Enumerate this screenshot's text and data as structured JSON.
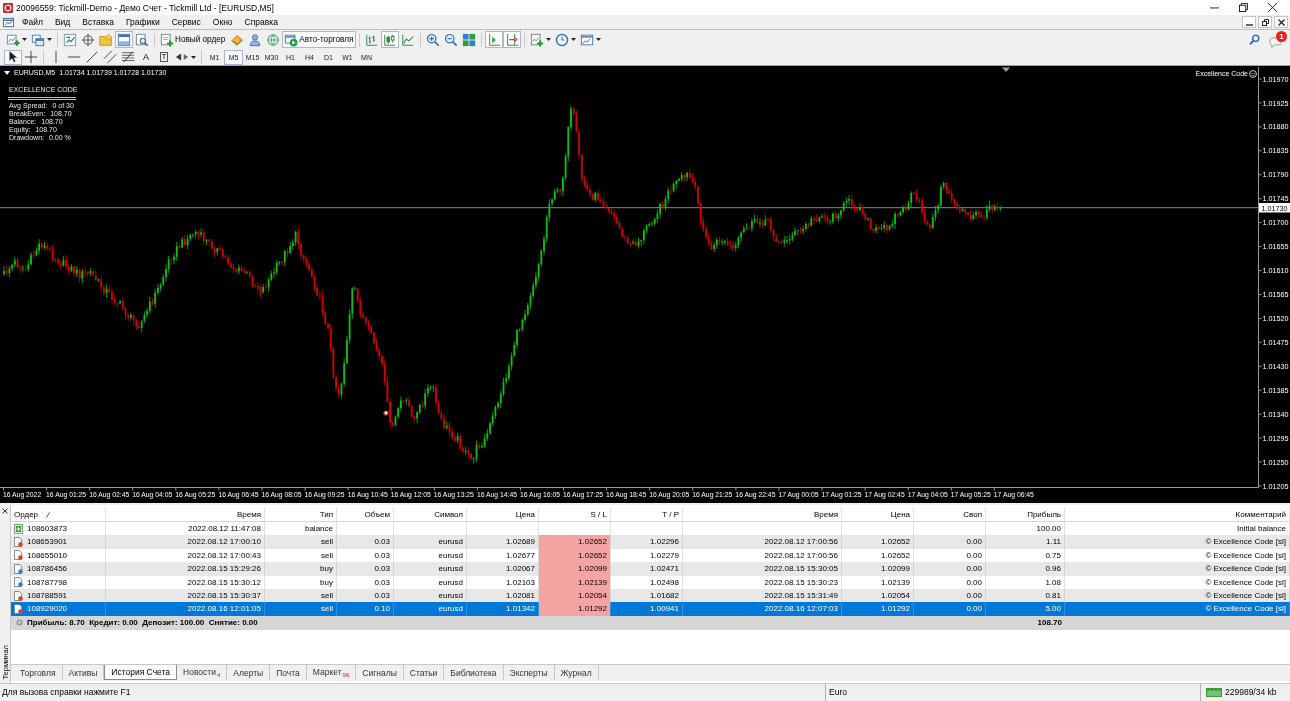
{
  "window": {
    "title": "20096559: Tickmill-Demo - Демо Счет - Tickmill Ltd - [EURUSD,M5]"
  },
  "menu": [
    "Файл",
    "Вид",
    "Вставка",
    "Графики",
    "Сервис",
    "Окно",
    "Справка"
  ],
  "toolbar": [
    [
      {
        "kind": "new-chart",
        "pressed": false
      },
      {
        "kind": "profiles",
        "pressed": false
      }
    ],
    [
      {
        "kind": "market-watch",
        "pressed": false
      },
      {
        "kind": "data-window",
        "pressed": false
      },
      {
        "kind": "navigator",
        "pressed": false
      },
      {
        "kind": "terminal",
        "pressed": true
      },
      {
        "kind": "tester",
        "pressed": false
      }
    ],
    [
      {
        "kind": "new-order",
        "label": "Новый ордер",
        "pressed": false
      },
      {
        "kind": "metaeditor",
        "pressed": false
      },
      {
        "kind": "signals",
        "pressed": false
      },
      {
        "kind": "market",
        "pressed": false
      },
      {
        "kind": "auto-trading",
        "label": "Авто-торговля",
        "pressed": true
      }
    ],
    [
      {
        "kind": "bar-chart",
        "pressed": false
      },
      {
        "kind": "candles",
        "pressed": true
      },
      {
        "kind": "line-chart",
        "pressed": false
      }
    ],
    [
      {
        "kind": "zoom-in",
        "pressed": false
      },
      {
        "kind": "zoom-out",
        "pressed": false
      },
      {
        "kind": "tile",
        "pressed": false
      }
    ],
    [
      {
        "kind": "autoscroll",
        "pressed": true
      },
      {
        "kind": "chart-shift",
        "pressed": true
      }
    ],
    [
      {
        "kind": "indicators",
        "pressed": false
      },
      {
        "kind": "periods",
        "pressed": false
      },
      {
        "kind": "templates",
        "pressed": false
      }
    ]
  ],
  "notifications": {
    "count": "1"
  },
  "drawing_toolbar": [
    [
      {
        "kind": "cursor",
        "pressed": true
      },
      {
        "kind": "crosshair",
        "pressed": false
      }
    ],
    [
      {
        "kind": "vline",
        "pressed": false
      },
      {
        "kind": "hline",
        "pressed": false
      },
      {
        "kind": "trendline",
        "pressed": false
      },
      {
        "kind": "channel",
        "pressed": false
      },
      {
        "kind": "fibo",
        "pressed": false
      },
      {
        "kind": "text-tool",
        "glyph": "A",
        "pressed": false
      },
      {
        "kind": "label-tool",
        "glyph": "T",
        "pressed": false
      },
      {
        "kind": "arrows",
        "pressed": false
      }
    ]
  ],
  "timeframes": [
    {
      "label": "M1",
      "selected": false
    },
    {
      "label": "M5",
      "selected": true
    },
    {
      "label": "M15",
      "selected": false
    },
    {
      "label": "M30",
      "selected": false
    },
    {
      "label": "H1",
      "selected": false
    },
    {
      "label": "H4",
      "selected": false
    },
    {
      "label": "D1",
      "selected": false
    },
    {
      "label": "W1",
      "selected": false
    },
    {
      "label": "MN",
      "selected": false
    }
  ],
  "chart": {
    "symbol": "EURUSD,M5",
    "quote": "1.01734 1.01739 1.01728 1.01730",
    "expert": "Excellence Code",
    "panel": {
      "title": "EXCELLENCE CODE",
      "stats": [
        {
          "label": "Avg Spread:",
          "value": "0 of 30"
        },
        {
          "label": "BreakEven:",
          "value": "108.70"
        },
        {
          "label": "Balance:",
          "value": "108.70"
        },
        {
          "label": "Equity:",
          "value": "108.70"
        },
        {
          "label": "Drawdown:",
          "value": "0.00 %"
        }
      ]
    },
    "price_labels": [
      "1.01970",
      "1.01925",
      "1.01880",
      "1.01835",
      "1.01790",
      "1.01745",
      "1.01700",
      "1.01655",
      "1.01610",
      "1.01565",
      "1.01520",
      "1.01475",
      "1.01430",
      "1.01385",
      "1.01340",
      "1.01295",
      "1.01250",
      "1.01205"
    ],
    "current_price": "1.01730",
    "time_labels": [
      "16 Aug 2022",
      "16 Aug 01:25",
      "16 Aug 02:45",
      "16 Aug 04:05",
      "16 Aug 05:25",
      "16 Aug 06:45",
      "16 Aug 08:05",
      "16 Aug 09:25",
      "16 Aug 10:45",
      "16 Aug 12:05",
      "16 Aug 13:25",
      "16 Aug 14:45",
      "16 Aug 16:05",
      "16 Aug 17:25",
      "16 Aug 18:45",
      "16 Aug 20:05",
      "16 Aug 21:25",
      "16 Aug 22:45",
      "17 Aug 00:05",
      "17 Aug 01:25",
      "17 Aug 02:45",
      "17 Aug 04:05",
      "17 Aug 05:25",
      "17 Aug 06:45"
    ]
  },
  "terminal": {
    "title": "Терминал",
    "columns": [
      "Ордер",
      "Время",
      "Тип",
      "Объем",
      "Символ",
      "Цена",
      "S / L",
      "T / P",
      "Время",
      "Цена",
      "Своп",
      "Прибыль",
      "Комментарий"
    ],
    "rows": [
      {
        "kind": "balance",
        "selected": false,
        "sl_hit": false,
        "order": "108603873",
        "open_time": "2022.08.12 11:47:08",
        "type": "balance",
        "profit": "100.00",
        "comment": "Initial balance"
      },
      {
        "kind": "sell",
        "selected": false,
        "sl_hit": true,
        "order": "108653901",
        "open_time": "2022.08.12 17:00:10",
        "type": "sell",
        "volume": "0.03",
        "symbol": "eurusd",
        "open_price": "1.02689",
        "sl": "1.02652",
        "tp": "1.02296",
        "close_time": "2022.08.12 17:00:56",
        "close_price": "1.02652",
        "swap": "0.00",
        "profit": "1.11",
        "comment": "© Excellence Code [sl]"
      },
      {
        "kind": "sell",
        "selected": false,
        "sl_hit": true,
        "order": "108655010",
        "open_time": "2022.08.12 17:00:43",
        "type": "sell",
        "volume": "0.03",
        "symbol": "eurusd",
        "open_price": "1.02677",
        "sl": "1.02652",
        "tp": "1.02279",
        "close_time": "2022.08.12 17:00:56",
        "close_price": "1.02652",
        "swap": "0.00",
        "profit": "0.75",
        "comment": "© Excellence Code [sl]"
      },
      {
        "kind": "buy",
        "selected": false,
        "sl_hit": true,
        "order": "108786456",
        "open_time": "2022.08.15 15:29:26",
        "type": "buy",
        "volume": "0.03",
        "symbol": "eurusd",
        "open_price": "1.02067",
        "sl": "1.02099",
        "tp": "1.02471",
        "close_time": "2022.08.15 15:30:05",
        "close_price": "1.02099",
        "swap": "0.00",
        "profit": "0.96",
        "comment": "© Excellence Code [sl]"
      },
      {
        "kind": "buy",
        "selected": false,
        "sl_hit": true,
        "order": "108787798",
        "open_time": "2022.08.15 15:30:12",
        "type": "buy",
        "volume": "0.03",
        "symbol": "eurusd",
        "open_price": "1.02103",
        "sl": "1.02139",
        "tp": "1.02498",
        "close_time": "2022.08.15 15:30:23",
        "close_price": "1.02139",
        "swap": "0.00",
        "profit": "1.08",
        "comment": "© Excellence Code [sl]"
      },
      {
        "kind": "sell",
        "selected": false,
        "sl_hit": true,
        "order": "108788591",
        "open_time": "2022.08.15 15:30:37",
        "type": "sell",
        "volume": "0.03",
        "symbol": "eurusd",
        "open_price": "1.02081",
        "sl": "1.02054",
        "tp": "1.01682",
        "close_time": "2022.08.15 15:31:49",
        "close_price": "1.02054",
        "swap": "0.00",
        "profit": "0.81",
        "comment": "© Excellence Code [sl]"
      },
      {
        "kind": "sell",
        "selected": true,
        "sl_hit": true,
        "order": "108929020",
        "open_time": "2022.08.16 12:01:05",
        "type": "sell",
        "volume": "0.10",
        "symbol": "eurusd",
        "open_price": "1.01342",
        "sl": "1.01292",
        "tp": "1.00941",
        "close_time": "2022.08.16 12:07:03",
        "close_price": "1.01292",
        "swap": "0.00",
        "profit": "5.00",
        "comment": "© Excellence Code [sl]"
      }
    ],
    "summary": {
      "text": "Прибыль: 8.70  Кредит: 0.00  Депозит: 100.00  Снятие: 0.00",
      "total": "108.70"
    },
    "tabs": [
      {
        "label": "Торговля",
        "selected": false
      },
      {
        "label": "Активы",
        "selected": false
      },
      {
        "label": "История Счета",
        "selected": true
      },
      {
        "label": "Новости",
        "badge": "4",
        "selected": false
      },
      {
        "label": "Алерты",
        "selected": false
      },
      {
        "label": "Почта",
        "selected": false
      },
      {
        "label": "Маркет",
        "badge": "96",
        "selected": false
      },
      {
        "label": "Сигналы",
        "selected": false
      },
      {
        "label": "Статьи",
        "selected": false
      },
      {
        "label": "Библиотека",
        "selected": false
      },
      {
        "label": "Эксперты",
        "selected": false
      },
      {
        "label": "Журнал",
        "selected": false
      }
    ]
  },
  "status_bar": {
    "help": "Для вызова справки нажмите F1",
    "profile": "Euro",
    "traffic": "229989/34 kb"
  }
}
